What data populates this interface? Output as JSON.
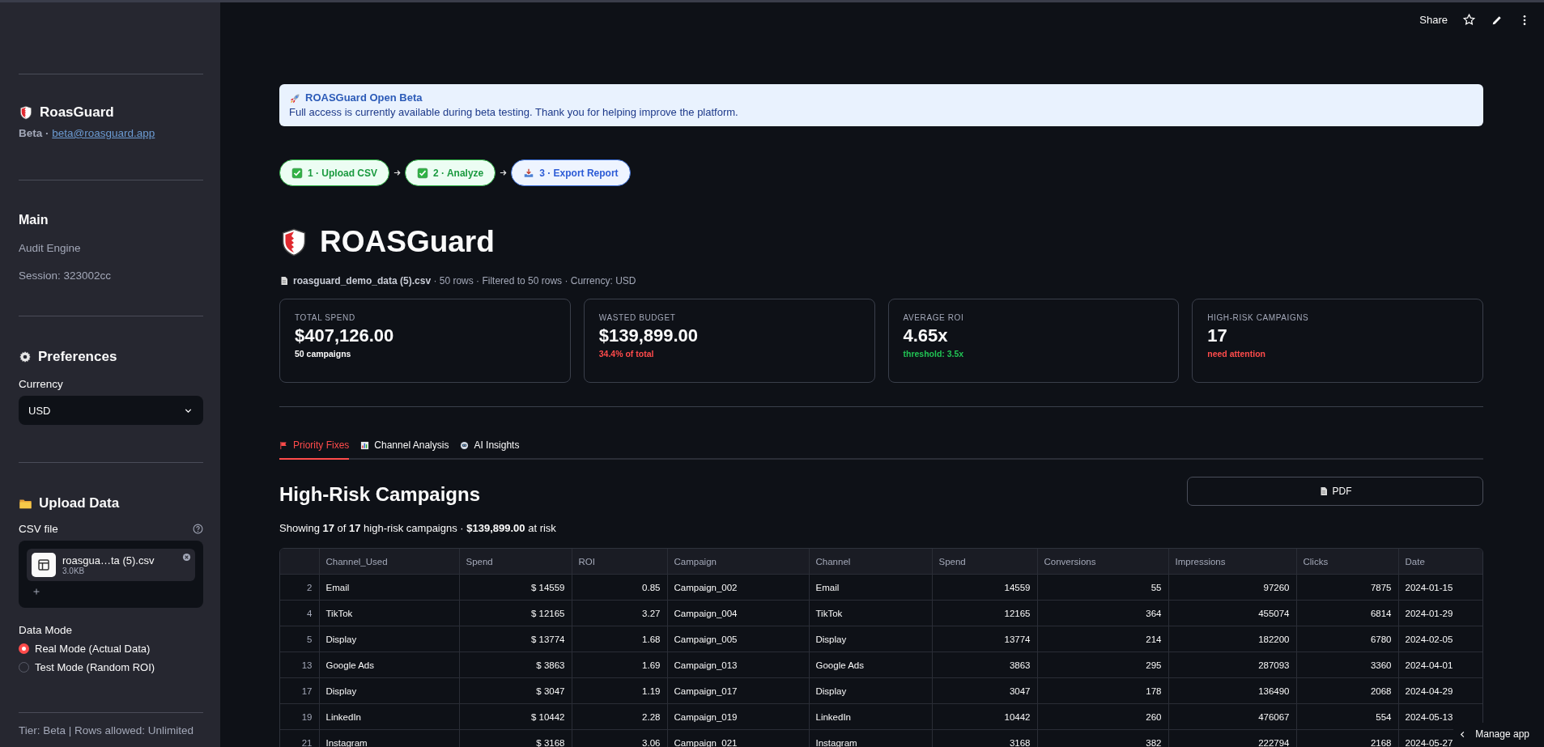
{
  "toolbar": {
    "share": "Share"
  },
  "sidebar": {
    "brand": {
      "title": "RoasGuard",
      "tag": "Beta ·",
      "email": "beta@roasguard.app"
    },
    "main": {
      "heading": "Main",
      "items": [
        "Audit Engine",
        "Session: 323002cc"
      ]
    },
    "preferences": {
      "heading": "Preferences",
      "currency_label": "Currency",
      "currency_value": "USD"
    },
    "upload": {
      "heading": "Upload Data",
      "label": "CSV file",
      "file_name": "roasgua…ta (5).csv",
      "file_size": "3.0KB"
    },
    "data_mode": {
      "label": "Data Mode",
      "options": [
        {
          "label": "Real Mode (Actual Data)",
          "selected": true
        },
        {
          "label": "Test Mode (Random ROI)",
          "selected": false
        }
      ]
    },
    "footer": "Tier: Beta | Rows allowed: Unlimited"
  },
  "banner": {
    "title": "ROASGuard Open Beta",
    "text": "Full access is currently available during beta testing. Thank you for helping improve the platform."
  },
  "steps": [
    {
      "label": "1 · Upload CSV",
      "done": true
    },
    {
      "label": "2 · Analyze",
      "done": true
    },
    {
      "label": "3 · Export Report",
      "done": false
    }
  ],
  "title": "ROASGuard",
  "file_info": "**roasguard_demo_data (5).csv** · 50 rows · Filtered to 50 rows · Currency: USD",
  "metrics": [
    {
      "label": "TOTAL SPEND",
      "value": "$407,126.00",
      "note": "50 campaigns",
      "color": "#fafafa"
    },
    {
      "label": "WASTED BUDGET",
      "value": "$139,899.00",
      "note": "34.4% of total",
      "color": "#ff4b4b"
    },
    {
      "label": "AVERAGE ROI",
      "value": "4.65x",
      "note": "threshold: 3.5x",
      "color": "#21c354"
    },
    {
      "label": "HIGH-RISK CAMPAIGNS",
      "value": "17",
      "note": "need attention",
      "color": "#ff4b4b"
    }
  ],
  "tabs": [
    {
      "label": "Priority Fixes",
      "selected": true
    },
    {
      "label": "Channel Analysis",
      "selected": false
    },
    {
      "label": "AI Insights",
      "selected": false
    }
  ],
  "section": {
    "heading": "High-Risk Campaigns",
    "pdf_button": "PDF",
    "summary": "Showing **17** of **17** high-risk campaigns · **$139,899.00** at risk"
  },
  "table": {
    "columns": [
      {
        "label": "Channel_Used"
      },
      {
        "label": "Spend"
      },
      {
        "label": "ROI"
      },
      {
        "label": "Campaign"
      },
      {
        "label": "Channel"
      },
      {
        "label": "Spend"
      },
      {
        "label": "Conversions"
      },
      {
        "label": "Impressions"
      },
      {
        "label": "Clicks"
      },
      {
        "label": "Date"
      }
    ],
    "rows": [
      {
        "index": "2",
        "cells": [
          "Email",
          "$ 14559",
          "0.85",
          "Campaign_002",
          "Email",
          "14559",
          "55",
          "97260",
          "7875",
          "2024-01-15"
        ]
      },
      {
        "index": "4",
        "cells": [
          "TikTok",
          "$ 12165",
          "3.27",
          "Campaign_004",
          "TikTok",
          "12165",
          "364",
          "455074",
          "6814",
          "2024-01-29"
        ]
      },
      {
        "index": "5",
        "cells": [
          "Display",
          "$ 13774",
          "1.68",
          "Campaign_005",
          "Display",
          "13774",
          "214",
          "182200",
          "6780",
          "2024-02-05"
        ]
      },
      {
        "index": "13",
        "cells": [
          "Google Ads",
          "$ 3863",
          "1.69",
          "Campaign_013",
          "Google Ads",
          "3863",
          "295",
          "287093",
          "3360",
          "2024-04-01"
        ]
      },
      {
        "index": "17",
        "cells": [
          "Display",
          "$ 3047",
          "1.19",
          "Campaign_017",
          "Display",
          "3047",
          "178",
          "136490",
          "2068",
          "2024-04-29"
        ]
      },
      {
        "index": "19",
        "cells": [
          "LinkedIn",
          "$ 10442",
          "2.28",
          "Campaign_019",
          "LinkedIn",
          "10442",
          "260",
          "476067",
          "554",
          "2024-05-13"
        ]
      },
      {
        "index": "21",
        "cells": [
          "Instagram",
          "$ 3168",
          "3.06",
          "Campaign_021",
          "Instagram",
          "3168",
          "382",
          "222794",
          "2168",
          "2024-05-27"
        ]
      }
    ]
  },
  "manage_app": "Manage app"
}
